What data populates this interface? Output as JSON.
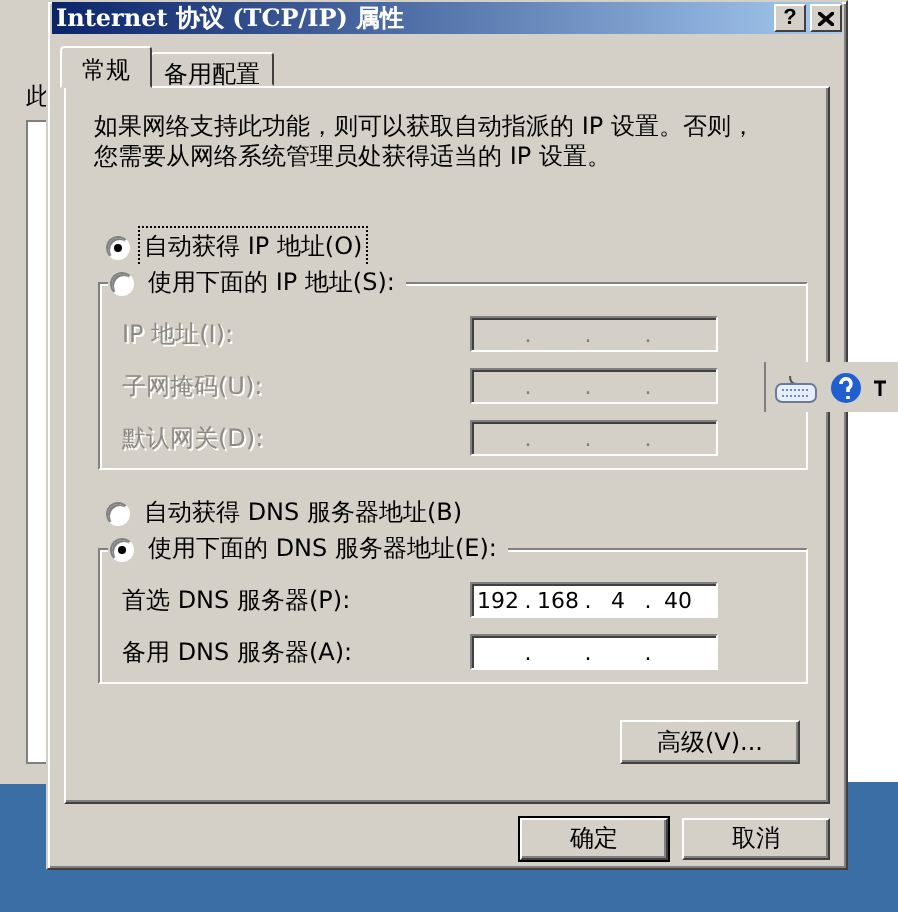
{
  "background_window": {
    "partial_text": "此"
  },
  "window": {
    "title": "Internet 协议 (TCP/IP) 属性",
    "help_button": "?"
  },
  "tabs": [
    {
      "label": "常规",
      "selected": true
    },
    {
      "label": "备用配置",
      "selected": false
    }
  ],
  "description": [
    "如果网络支持此功能，则可以获取自动指派的 IP 设置。否则，",
    "您需要从网络系统管理员处获得适当的 IP 设置。"
  ],
  "separator": ".",
  "ip_section": {
    "options": [
      {
        "label": "自动获得 IP 地址(O)",
        "selected": true,
        "focused": true
      },
      {
        "label": "使用下面的 IP 地址(S):",
        "selected": false,
        "focused": false
      }
    ],
    "fields": [
      {
        "label": "IP 地址(I):",
        "disabled": true
      },
      {
        "label": "子网掩码(U):",
        "disabled": true
      },
      {
        "label": "默认网关(D):",
        "disabled": true
      }
    ]
  },
  "dns_section": {
    "options": [
      {
        "label": "自动获得 DNS 服务器地址(B)",
        "selected": false,
        "focused": false
      },
      {
        "label": "使用下面的 DNS 服务器地址(E):",
        "selected": true,
        "focused": false
      }
    ],
    "fields": [
      {
        "label": "首选 DNS 服务器(P):",
        "disabled": false,
        "octets": [
          "192",
          "168",
          "4",
          "40"
        ]
      },
      {
        "label": "备用 DNS 服务器(A):",
        "disabled": false
      }
    ]
  },
  "advanced_button": "高级(V)...",
  "buttons": [
    {
      "label": "确定",
      "default": true
    },
    {
      "label": "取消",
      "default": false
    }
  ]
}
